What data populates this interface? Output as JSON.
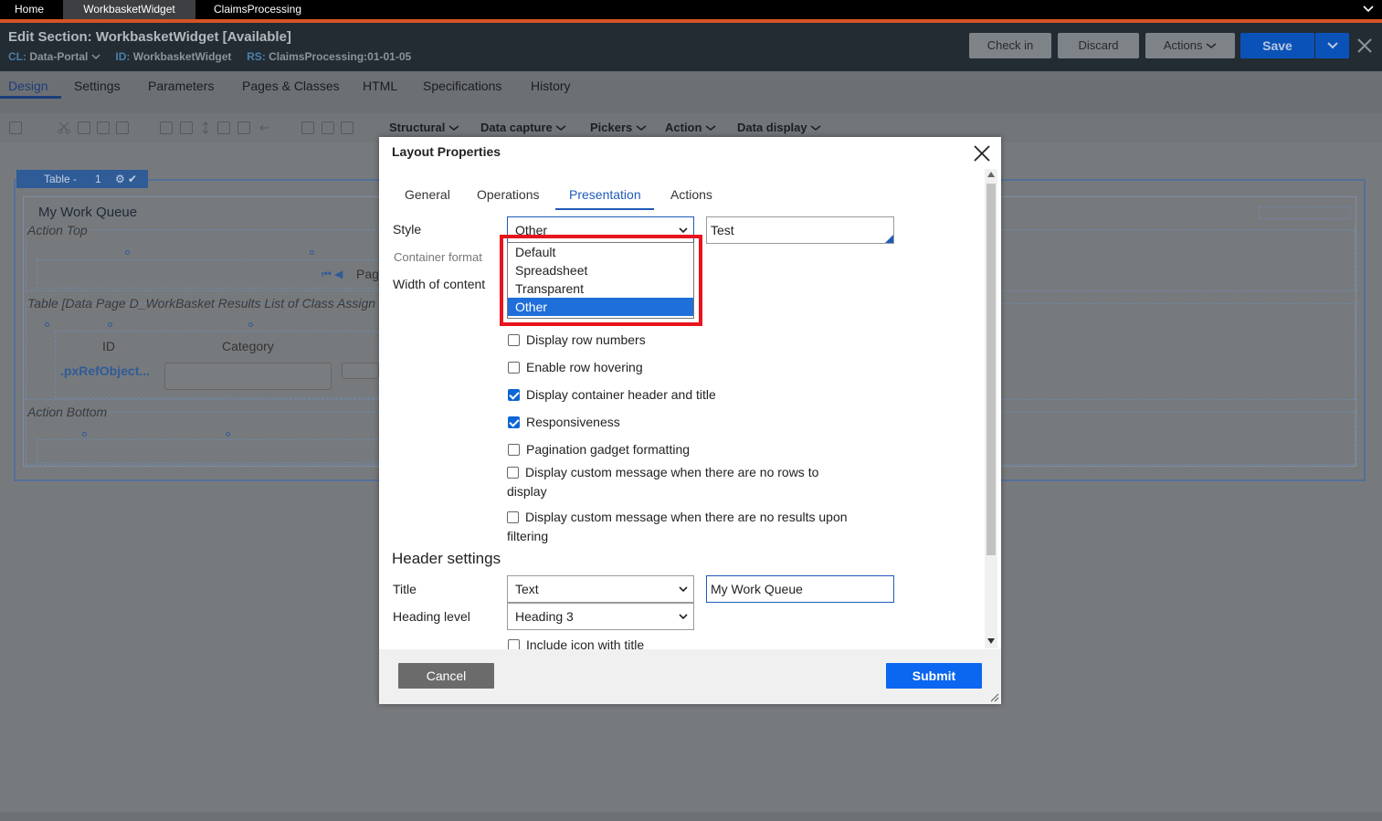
{
  "tabs": {
    "home": "Home",
    "workbasket": "WorkbasketWidget",
    "claims": "ClaimsProcessing"
  },
  "header": {
    "title": "Edit  Section: WorkbasketWidget [Available]",
    "cl_key": "CL:",
    "cl_value": "Data-Portal",
    "id_key": "ID:",
    "id_value": "WorkbasketWidget",
    "rs_key": "RS:",
    "rs_value": "ClaimsProcessing:01-01-05",
    "check_in": "Check in",
    "discard": "Discard",
    "actions": "Actions",
    "save": "Save"
  },
  "subnav": {
    "design": "Design",
    "settings": "Settings",
    "parameters": "Parameters",
    "pages_classes": "Pages & Classes",
    "html": "HTML",
    "specifications": "Specifications",
    "history": "History"
  },
  "toolbar": {
    "structural": "Structural",
    "data_capture": "Data capture",
    "pickers": "Pickers",
    "action": "Action",
    "data_display": "Data display"
  },
  "canvas": {
    "table_label": "Table -",
    "table_index": "1",
    "queue_title": "My Work Queue",
    "action_top": "Action Top",
    "pager_text": "Pag",
    "table_desc": "Table [Data Page D_WorkBasket Results List of Class Assign",
    "col_id": "ID",
    "col_category": "Category",
    "cell_ref": ".pxRefObject...",
    "action_bottom": "Action Bottom"
  },
  "modal": {
    "title": "Layout Properties",
    "tabs": {
      "general": "General",
      "operations": "Operations",
      "presentation": "Presentation",
      "actions": "Actions"
    },
    "style_label": "Style",
    "style_value": "Other",
    "style_text": "Test",
    "container_format_label": "Container format",
    "width_label": "Width of content",
    "dropdown_options": [
      "Default",
      "Spreadsheet",
      "Transparent",
      "Other"
    ],
    "dropdown_selected": "Other",
    "checks": {
      "row_numbers": "Display row numbers",
      "row_hover": "Enable row hovering",
      "container_header": "Display container header and title",
      "responsiveness": "Responsiveness",
      "pagination": "Pagination gadget formatting",
      "no_rows_msg": "Display custom message when there are no rows to display",
      "no_results_msg": "Display custom message when there are no results upon filtering",
      "include_icon": "Include icon with title"
    },
    "check_states": {
      "row_numbers": false,
      "row_hover": false,
      "container_header": true,
      "responsiveness": true,
      "pagination": false,
      "no_rows_msg": false,
      "no_results_msg": false,
      "include_icon": false
    },
    "header_settings": "Header settings",
    "title_label": "Title",
    "title_type": "Text",
    "title_value": "My Work Queue",
    "heading_label": "Heading level",
    "heading_value": "Heading 3",
    "cancel": "Cancel",
    "submit": "Submit"
  },
  "colors": {
    "accent_orange": "#d45426",
    "submit_blue": "#0b66f0",
    "highlight_red": "#e8141e",
    "selected_option": "#1e6fd9"
  }
}
